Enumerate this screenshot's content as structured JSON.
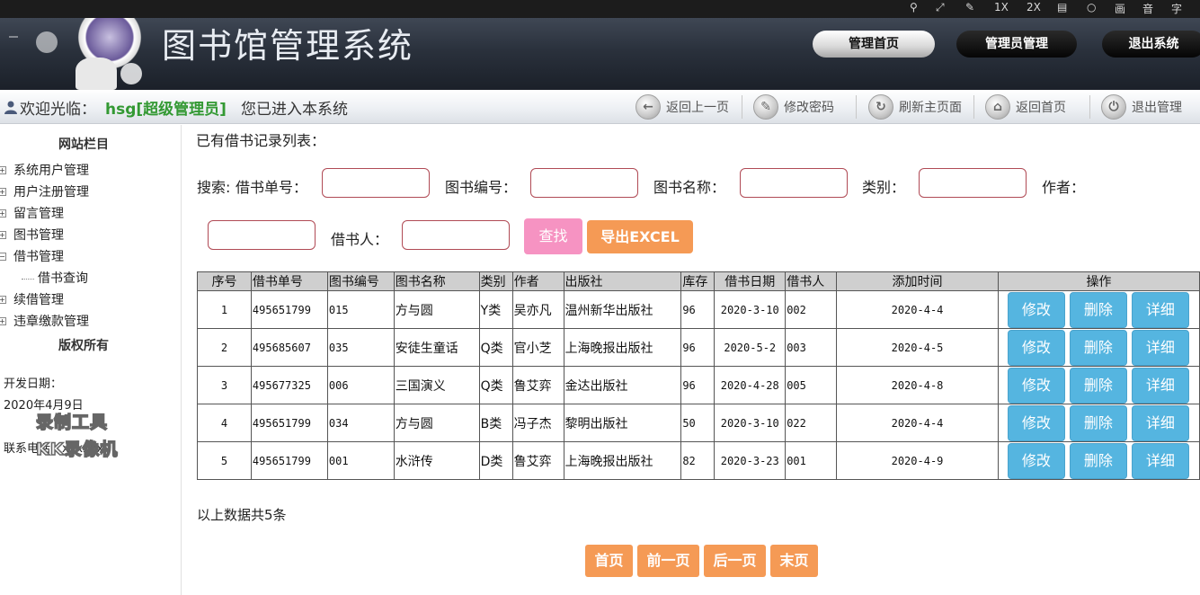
{
  "recorder_bar": {
    "zoom_1x": "1X",
    "zoom_2x": "2X",
    "audio_label": "音",
    "subtitle_label": "字",
    "picture_label": "画"
  },
  "header": {
    "title": "图书馆管理系统",
    "buttons": {
      "home": "管理首页",
      "admin": "管理员管理",
      "logout": "退出系统"
    }
  },
  "welcome": {
    "prefix": "欢迎光临：",
    "user": "hsg[超级管理员]",
    "suffix": "您已进入本系统",
    "nav": [
      {
        "label": "返回上一页",
        "icon": "back-arrow-icon"
      },
      {
        "label": "修改密码",
        "icon": "edit-password-icon"
      },
      {
        "label": "刷新主页面",
        "icon": "refresh-icon"
      },
      {
        "label": "返回首页",
        "icon": "home-icon"
      },
      {
        "label": "退出管理",
        "icon": "power-icon"
      }
    ]
  },
  "sidebar": {
    "heading": "网站栏目",
    "items": [
      "系统用户管理",
      "用户注册管理",
      "留言管理",
      "图书管理",
      "借书管理"
    ],
    "sub_items": [
      "借书查询"
    ],
    "items_after": [
      "续借管理",
      "违章缴款管理"
    ],
    "copyright_heading": "版权所有",
    "dev_date_label": "开发日期：",
    "dev_date_value": "2020年4月9日",
    "contact_label": "联系电话：xxxxxx",
    "watermark_line1": "录制工具",
    "watermark_line2": "KK录像机"
  },
  "main": {
    "title": "已有借书记录列表：",
    "search": {
      "label_prefix": "搜索:",
      "fields": {
        "order_no": "借书单号：",
        "book_no": "图书编号：",
        "book_name": "图书名称：",
        "category": "类别：",
        "author": "作者：",
        "borrower": "借书人："
      },
      "search_button": "查找",
      "export_button": "导出EXCEL"
    },
    "table": {
      "headers": [
        "序号",
        "借书单号",
        "图书编号",
        "图书名称",
        "类别",
        "作者",
        "出版社",
        "库存",
        "借书日期",
        "借书人",
        "添加时间",
        "操作"
      ],
      "rows": [
        [
          "1",
          "495651799",
          "015",
          "方与圆",
          "Y类",
          "吴亦凡",
          "温州新华出版社",
          "96",
          "2020-3-10",
          "002",
          "2020-4-4"
        ],
        [
          "2",
          "495685607",
          "035",
          "安徒生童话",
          "Q类",
          "官小芝",
          "上海晚报出版社",
          "96",
          "2020-5-2",
          "003",
          "2020-4-5"
        ],
        [
          "3",
          "495677325",
          "006",
          "三国演义",
          "Q类",
          "鲁艾弈",
          "金达出版社",
          "96",
          "2020-4-28",
          "005",
          "2020-4-8"
        ],
        [
          "4",
          "495651799",
          "034",
          "方与圆",
          "B类",
          "冯子杰",
          "黎明出版社",
          "50",
          "2020-3-10",
          "022",
          "2020-4-4"
        ],
        [
          "5",
          "495651799",
          "001",
          "水浒传",
          "D类",
          "鲁艾弈",
          "上海晚报出版社",
          "82",
          "2020-3-23",
          "001",
          "2020-4-9"
        ]
      ],
      "actions": {
        "edit": "修改",
        "delete": "删除",
        "detail": "详细"
      }
    },
    "count_text": "以上数据共5条",
    "pagination": {
      "first": "首页",
      "prev": "前一页",
      "next": "后一页",
      "last": "末页"
    }
  }
}
